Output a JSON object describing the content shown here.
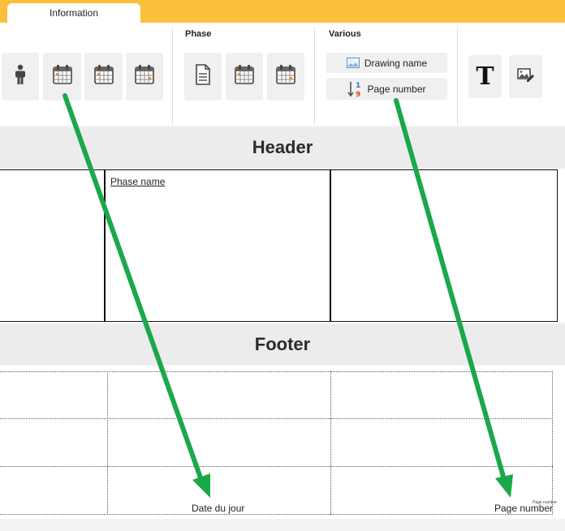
{
  "tab": {
    "label": "Information"
  },
  "groups": {
    "phase_title": "Phase",
    "various_title": "Various"
  },
  "buttons": {
    "drawing_name": "Drawing name",
    "page_number": "Page number",
    "text_tool_glyph": "T"
  },
  "icons": {
    "person": "person-icon",
    "calendar": "calendar-icon",
    "document": "document-icon",
    "image": "image-icon",
    "sort_numbers": "sort-numbers-icon",
    "text": "text-icon",
    "edit_image": "edit-image-icon"
  },
  "sort_icon_digits": {
    "top": "1",
    "bottom": "9"
  },
  "sections": {
    "header": "Header",
    "footer": "Footer"
  },
  "header_cells": {
    "phase_name": "Phase name"
  },
  "footer_cells": {
    "date": "Date du jour",
    "page": "Page number",
    "page_small": "Page number"
  },
  "colors": {
    "accent": "#fbbf3c",
    "arrow": "#1aa84a"
  }
}
